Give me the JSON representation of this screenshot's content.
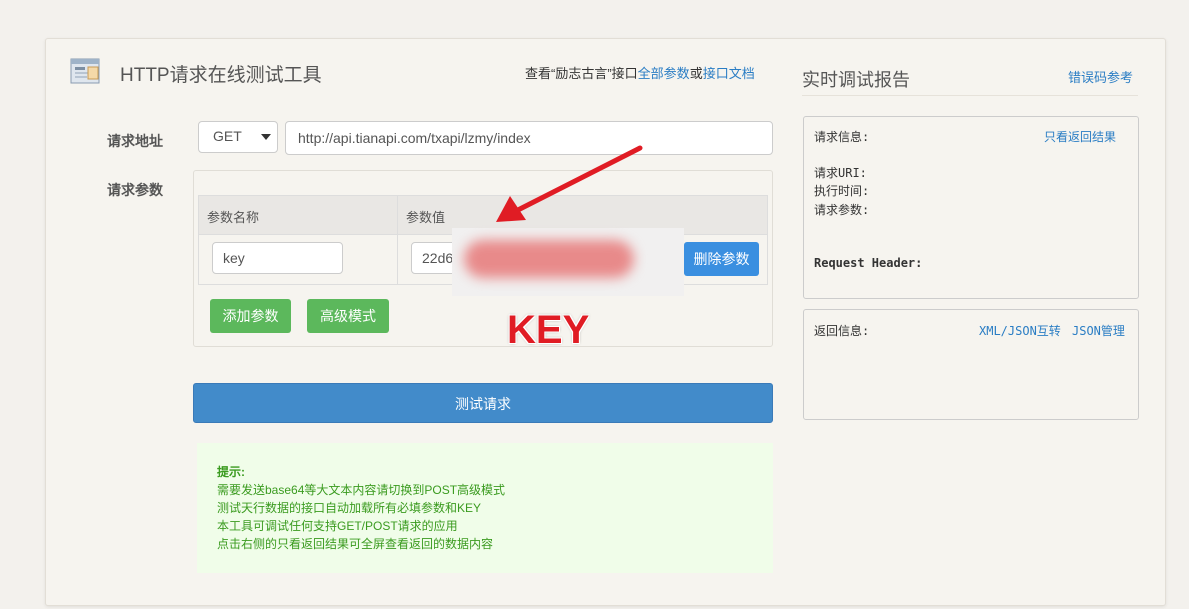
{
  "header": {
    "title": "HTTP请求在线测试工具",
    "note_prefix": "查看“励志古言”接口",
    "link_all_params": "全部参数",
    "note_or": "或",
    "link_api_doc": "接口文档"
  },
  "request": {
    "url_label": "请求地址",
    "method": "GET",
    "url": "http://api.tianapi.com/txapi/lzmy/index",
    "params_label": "请求参数",
    "table_headers": [
      "参数名称",
      "参数值"
    ],
    "param_name": "key",
    "param_value_visible": "22d6",
    "delete_label": "删除参数",
    "add_label": "添加参数",
    "advanced_label": "高级模式",
    "test_label": "测试请求"
  },
  "annotation": {
    "text": "KEY",
    "color": "#e01c24"
  },
  "tips": {
    "title": "提示:",
    "lines": [
      "需要发送base64等大文本内容请切换到POST高级模式",
      "测试天行数据的接口自动加载所有必填参数和KEY",
      "本工具可调试任何支持GET/POST请求的应用",
      "点击右侧的只看返回结果可全屏查看返回的数据内容"
    ]
  },
  "report": {
    "title": "实时调试报告",
    "error_codes_link": "错误码参考",
    "request_info_label": "请求信息:",
    "only_result_link": "只看返回结果",
    "request_uri_label": "请求URI:",
    "exec_time_label": "执行时间:",
    "request_params_label": "请求参数:",
    "request_header_label": "Request Header:",
    "response_info_label": "返回信息:",
    "xml_json_link": "XML/JSON互转",
    "json_manage_link": "JSON管理"
  },
  "colors": {
    "green": "#5cb85c",
    "blue": "#428bca",
    "link": "#2a7dc4"
  }
}
